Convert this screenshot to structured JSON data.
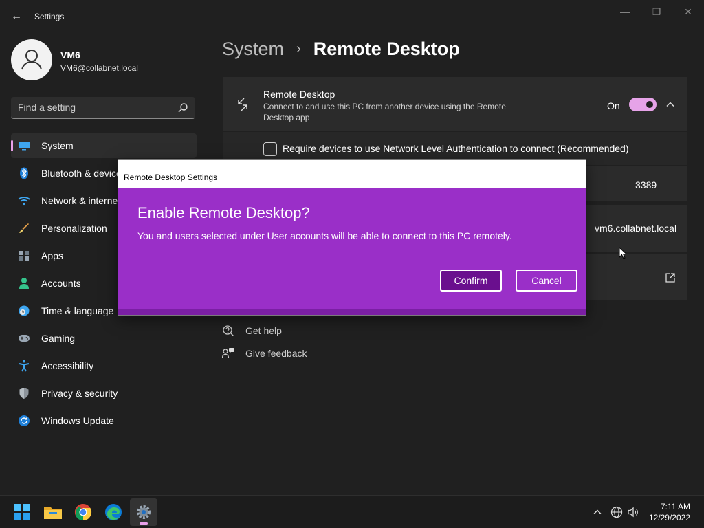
{
  "window": {
    "title": "Settings",
    "back_glyph": "←",
    "controls": {
      "minimize": "—",
      "maximize": "❐",
      "close": "✕"
    }
  },
  "profile": {
    "name": "VM6",
    "email": "VM6@collabnet.local",
    "avatar_icon": "user-icon"
  },
  "search": {
    "placeholder": "Find a setting",
    "icon": "search-icon"
  },
  "sidebar": {
    "accent_color": "#e9a0ea",
    "items": [
      {
        "label": "System",
        "icon": "system-display-icon",
        "active": true
      },
      {
        "label": "Bluetooth & devices",
        "icon": "bluetooth-icon"
      },
      {
        "label": "Network & internet",
        "icon": "wifi-icon"
      },
      {
        "label": "Personalization",
        "icon": "brush-icon"
      },
      {
        "label": "Apps",
        "icon": "apps-icon"
      },
      {
        "label": "Accounts",
        "icon": "account-icon"
      },
      {
        "label": "Time & language",
        "icon": "clock-globe-icon"
      },
      {
        "label": "Gaming",
        "icon": "gamepad-icon"
      },
      {
        "label": "Accessibility",
        "icon": "accessibility-icon"
      },
      {
        "label": "Privacy & security",
        "icon": "shield-icon"
      },
      {
        "label": "Windows Update",
        "icon": "update-icon"
      }
    ]
  },
  "page": {
    "breadcrumb_parent": "System",
    "breadcrumb_separator": "›",
    "breadcrumb_current": "Remote Desktop"
  },
  "remote_desktop": {
    "title": "Remote Desktop",
    "description": "Connect to and use this PC from another device using the Remote Desktop app",
    "state_label": "On",
    "enabled": true,
    "toggle_color": "#e6a3e8"
  },
  "nla": {
    "label": "Require devices to use Network Level Authentication to connect (Recommended)",
    "checked": false
  },
  "port": {
    "value": "3389"
  },
  "pc_name": {
    "value": "vm6.collabnet.local"
  },
  "related": {
    "get_help": "Get help",
    "give_feedback": "Give feedback"
  },
  "dialog": {
    "window_title": "Remote Desktop Settings",
    "heading": "Enable Remote Desktop?",
    "message": "You and users selected under User accounts will be able to connect to this PC remotely.",
    "confirm_label": "Confirm",
    "cancel_label": "Cancel",
    "background_color": "#9a2fc8",
    "confirm_color": "#6a0f8e"
  },
  "taskbar": {
    "apps": [
      {
        "name": "start",
        "icon": "windows-logo-icon"
      },
      {
        "name": "file-explorer",
        "icon": "folder-icon"
      },
      {
        "name": "chrome",
        "icon": "chrome-icon"
      },
      {
        "name": "edge",
        "icon": "edge-icon"
      },
      {
        "name": "settings",
        "icon": "gear-icon",
        "active": true
      }
    ],
    "tray": {
      "chevron_icon": "chevron-up-icon",
      "network_icon": "globe-icon",
      "volume_icon": "volume-icon"
    },
    "time": "7:11 AM",
    "date": "12/29/2022"
  }
}
